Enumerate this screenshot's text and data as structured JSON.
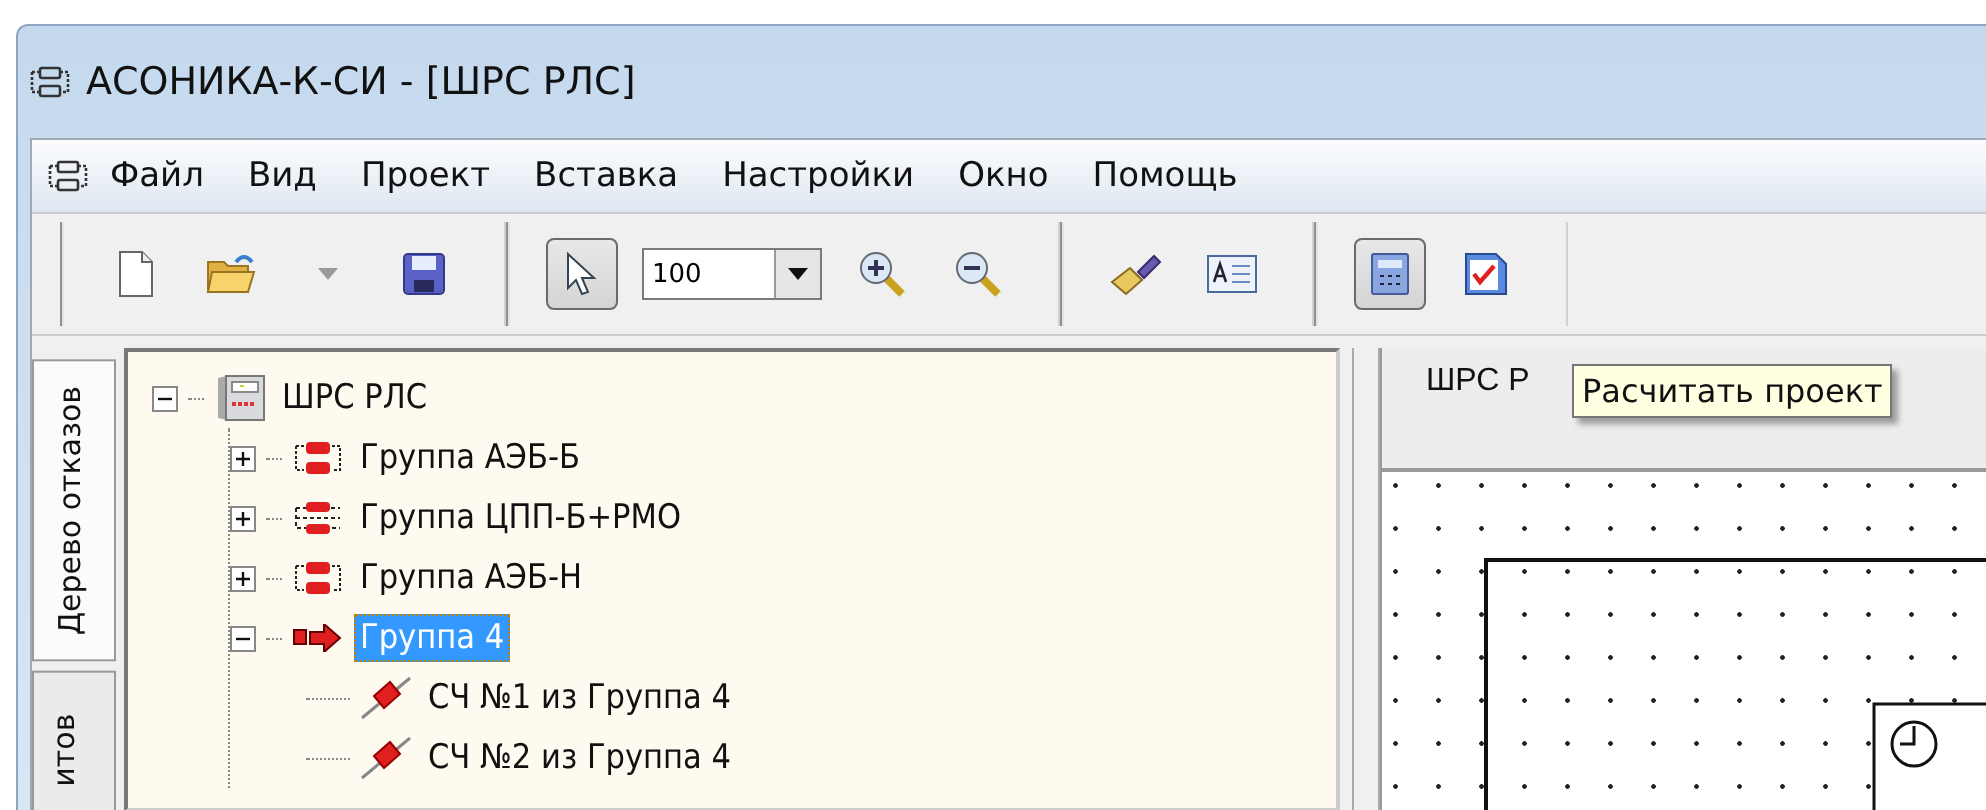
{
  "window": {
    "title": "АСОНИКА-К-СИ - [ШРС РЛС]"
  },
  "menu": [
    "Файл",
    "Вид",
    "Проект",
    "Вставка",
    "Настройки",
    "Окно",
    "Помощь"
  ],
  "toolbar": [
    [
      {
        "kind": "new",
        "pressed": false
      },
      {
        "kind": "open",
        "pressed": false
      },
      {
        "kind": "dropdown",
        "pressed": false
      },
      {
        "kind": "save",
        "pressed": false
      }
    ],
    [
      {
        "kind": "pointer",
        "pressed": true
      },
      {
        "kind": "zoom-combo",
        "value": "100"
      },
      {
        "kind": "zoom-in",
        "pressed": false
      },
      {
        "kind": "zoom-out",
        "pressed": false
      }
    ],
    [
      {
        "kind": "brush",
        "pressed": false
      },
      {
        "kind": "text",
        "pressed": false
      }
    ],
    [
      {
        "kind": "calculate",
        "pressed": true
      },
      {
        "kind": "check",
        "pressed": false
      }
    ]
  ],
  "side_tabs": [
    {
      "label": "Дерево отказов",
      "selected": true
    },
    {
      "label": "итов",
      "selected": false
    }
  ],
  "tree": [
    {
      "label": "ШРС РЛС",
      "kind": "cabinet",
      "expanded": true,
      "selected": false,
      "children": [
        {
          "label": "Группа АЭБ-Б",
          "kind": "group",
          "expanded": false,
          "selected": false
        },
        {
          "label": "Группа ЦПП-Б+РМО",
          "kind": "group-dashed",
          "expanded": false,
          "selected": false
        },
        {
          "label": "Группа АЭБ-Н",
          "kind": "group",
          "expanded": false,
          "selected": false
        },
        {
          "label": "Группа 4",
          "kind": "arrow",
          "expanded": true,
          "selected": true,
          "children": [
            {
              "label": "СЧ №1 из Группа 4",
              "kind": "resistor",
              "selected": false
            },
            {
              "label": "СЧ №2 из Группа 4",
              "kind": "resistor",
              "selected": false
            }
          ]
        }
      ]
    }
  ],
  "document": {
    "tab": "ШРС Р",
    "tooltip": "Расчитать проект"
  }
}
